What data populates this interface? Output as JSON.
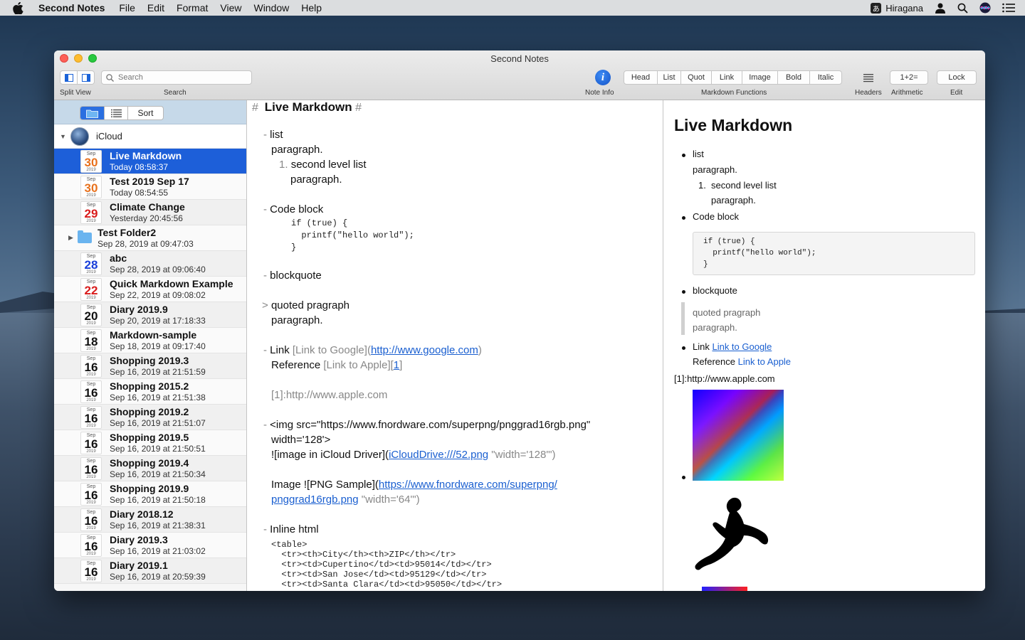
{
  "menubar": {
    "app_name": "Second Notes",
    "items": [
      "File",
      "Edit",
      "Format",
      "View",
      "Window",
      "Help"
    ],
    "input_method": "Hiragana",
    "ime_glyph": "あ"
  },
  "window": {
    "title": "Second Notes"
  },
  "toolbar": {
    "split_view_label": "Split View",
    "search_placeholder": "Search",
    "search_label": "Search",
    "note_info_label": "Note Info",
    "markdown_buttons": [
      "Head",
      "List",
      "Quot",
      "Link",
      "Image",
      "Bold",
      "Italic"
    ],
    "markdown_functions_label": "Markdown Functions",
    "headers_label": "Headers",
    "arithmetic_button": "1+2=",
    "arithmetic_label": "Arithmetic",
    "lock_button": "Lock",
    "edit_label": "Edit"
  },
  "sidebar": {
    "sort_label": "Sort",
    "root_label": "iCloud",
    "notes": [
      {
        "title": "Live Markdown",
        "subtitle": "Today 08:58:37",
        "month": "Sep",
        "day": "30",
        "year": "2019",
        "day_color": "#e8711d",
        "selected": true
      },
      {
        "title": "Test 2019 Sep 17",
        "subtitle": "Today 08:54:55",
        "month": "Sep",
        "day": "30",
        "year": "2019",
        "day_color": "#e8711d"
      },
      {
        "title": "Climate Change",
        "subtitle": "Yesterday 20:45:56",
        "month": "Sep",
        "day": "29",
        "year": "2019",
        "day_color": "#d91c1c"
      },
      {
        "title": "Test Folder2",
        "subtitle": "Sep 28, 2019 at 09:47:03",
        "is_folder": true
      },
      {
        "title": "abc",
        "subtitle": "Sep 28, 2019 at 09:06:40",
        "month": "Sep",
        "day": "28",
        "year": "2019",
        "day_color": "#1a3fd9"
      },
      {
        "title": "Quick Markdown Example",
        "subtitle": "Sep 22, 2019 at 09:08:02",
        "month": "Sep",
        "day": "22",
        "year": "2019",
        "day_color": "#d91c1c"
      },
      {
        "title": "Diary 2019.9",
        "subtitle": "Sep 20, 2019 at 17:18:33",
        "month": "Sep",
        "day": "20",
        "year": "2019",
        "day_color": "#111111"
      },
      {
        "title": "Markdown-sample",
        "subtitle": "Sep 18, 2019 at 09:17:40",
        "month": "Sep",
        "day": "18",
        "year": "2019",
        "day_color": "#111111"
      },
      {
        "title": "Shopping 2019.3",
        "subtitle": "Sep 16, 2019 at 21:51:59",
        "month": "Sep",
        "day": "16",
        "year": "2019",
        "day_color": "#111111"
      },
      {
        "title": "Shopping 2015.2",
        "subtitle": "Sep 16, 2019 at 21:51:38",
        "month": "Sep",
        "day": "16",
        "year": "2019",
        "day_color": "#111111"
      },
      {
        "title": "Shopping 2019.2",
        "subtitle": "Sep 16, 2019 at 21:51:07",
        "month": "Sep",
        "day": "16",
        "year": "2019",
        "day_color": "#111111"
      },
      {
        "title": "Shopping 2019.5",
        "subtitle": "Sep 16, 2019 at 21:50:51",
        "month": "Sep",
        "day": "16",
        "year": "2019",
        "day_color": "#111111"
      },
      {
        "title": "Shopping 2019.4",
        "subtitle": "Sep 16, 2019 at 21:50:34",
        "month": "Sep",
        "day": "16",
        "year": "2019",
        "day_color": "#111111"
      },
      {
        "title": "Shopping 2019.9",
        "subtitle": "Sep 16, 2019 at 21:50:18",
        "month": "Sep",
        "day": "16",
        "year": "2019",
        "day_color": "#111111"
      },
      {
        "title": "Diary 2018.12",
        "subtitle": "Sep 16, 2019 at 21:38:31",
        "month": "Sep",
        "day": "16",
        "year": "2019",
        "day_color": "#111111"
      },
      {
        "title": "Diary 2019.3",
        "subtitle": "Sep 16, 2019 at 21:03:02",
        "month": "Sep",
        "day": "16",
        "year": "2019",
        "day_color": "#111111"
      },
      {
        "title": "Diary 2019.1",
        "subtitle": "Sep 16, 2019 at 20:59:39",
        "month": "Sep",
        "day": "16",
        "year": "2019",
        "day_color": "#111111"
      }
    ]
  },
  "editor": {
    "h1_mark_open": "#",
    "h1_text": "Live Markdown",
    "h1_mark_close": "#",
    "list_dash": "-",
    "list_item": "list",
    "paragraph": "paragraph.",
    "ol_marker": "1.",
    "second_level": "second level list",
    "paragraph2": "paragraph.",
    "code_block_title": "Code block",
    "code_line1": "if (true) {",
    "code_line2": "  printf(\"hello world\");",
    "code_line3": "}",
    "blockquote": "blockquote",
    "quote_marker": ">",
    "quoted": "quoted pragraph",
    "quoted_para": "paragraph.",
    "link_prefix": "Link ",
    "link_bracket": "[Link to Google]",
    "link_paren_open": "(",
    "link_url": "http://www.google.com",
    "link_paren_close": ")",
    "ref_prefix": "Reference ",
    "ref_bracket": "[Link to Apple]",
    "ref_num_open": "[",
    "ref_num": "1",
    "ref_num_close": "]",
    "ref_def": "[1]:http://www.apple.com",
    "img_line1": "<img src=\"https://www.fnordware.com/superpng/pnggrad16rgb.png\"",
    "img_line2": "width='128'>",
    "img_icloud_prefix": "![image in iCloud Driver](",
    "img_icloud_url": "iCloudDrive:///52.png",
    "img_icloud_suffix": " \"width='128'\")",
    "image_prefix": "Image ![PNG Sample](",
    "image_url1": "https://www.fnordware.com/superpng/",
    "image_url2": "pnggrad16rgb.png",
    "image_suffix": " \"width='64'\")",
    "inline_html": "Inline html",
    "html_lines": [
      "<table>",
      "  <tr><th>City</th><th>ZIP</th></tr>",
      "  <tr><td>Cupertino</td><td>95014</td></tr>",
      "  <tr><td>San Jose</td><td>95129</td></tr>",
      "  <tr><td>Santa Clara</td><td>95050</td></tr>"
    ]
  },
  "preview": {
    "h1": "Live Markdown",
    "list": "list",
    "paragraph": "paragraph.",
    "ol_num": "1.",
    "second_level": "second level list",
    "paragraph2": "paragraph.",
    "code_block": "Code block",
    "code_line1": "if (true) {",
    "code_line2": "  printf(\"hello world\");",
    "code_line3": "}",
    "blockquote": "blockquote",
    "quoted": "quoted pragraph",
    "quoted_para": "paragraph.",
    "link_prefix": "Link ",
    "link_text": "Link to Google",
    "ref_prefix": "Reference ",
    "ref_text": "Link to Apple",
    "ref_def": "[1]:http://www.apple.com"
  }
}
